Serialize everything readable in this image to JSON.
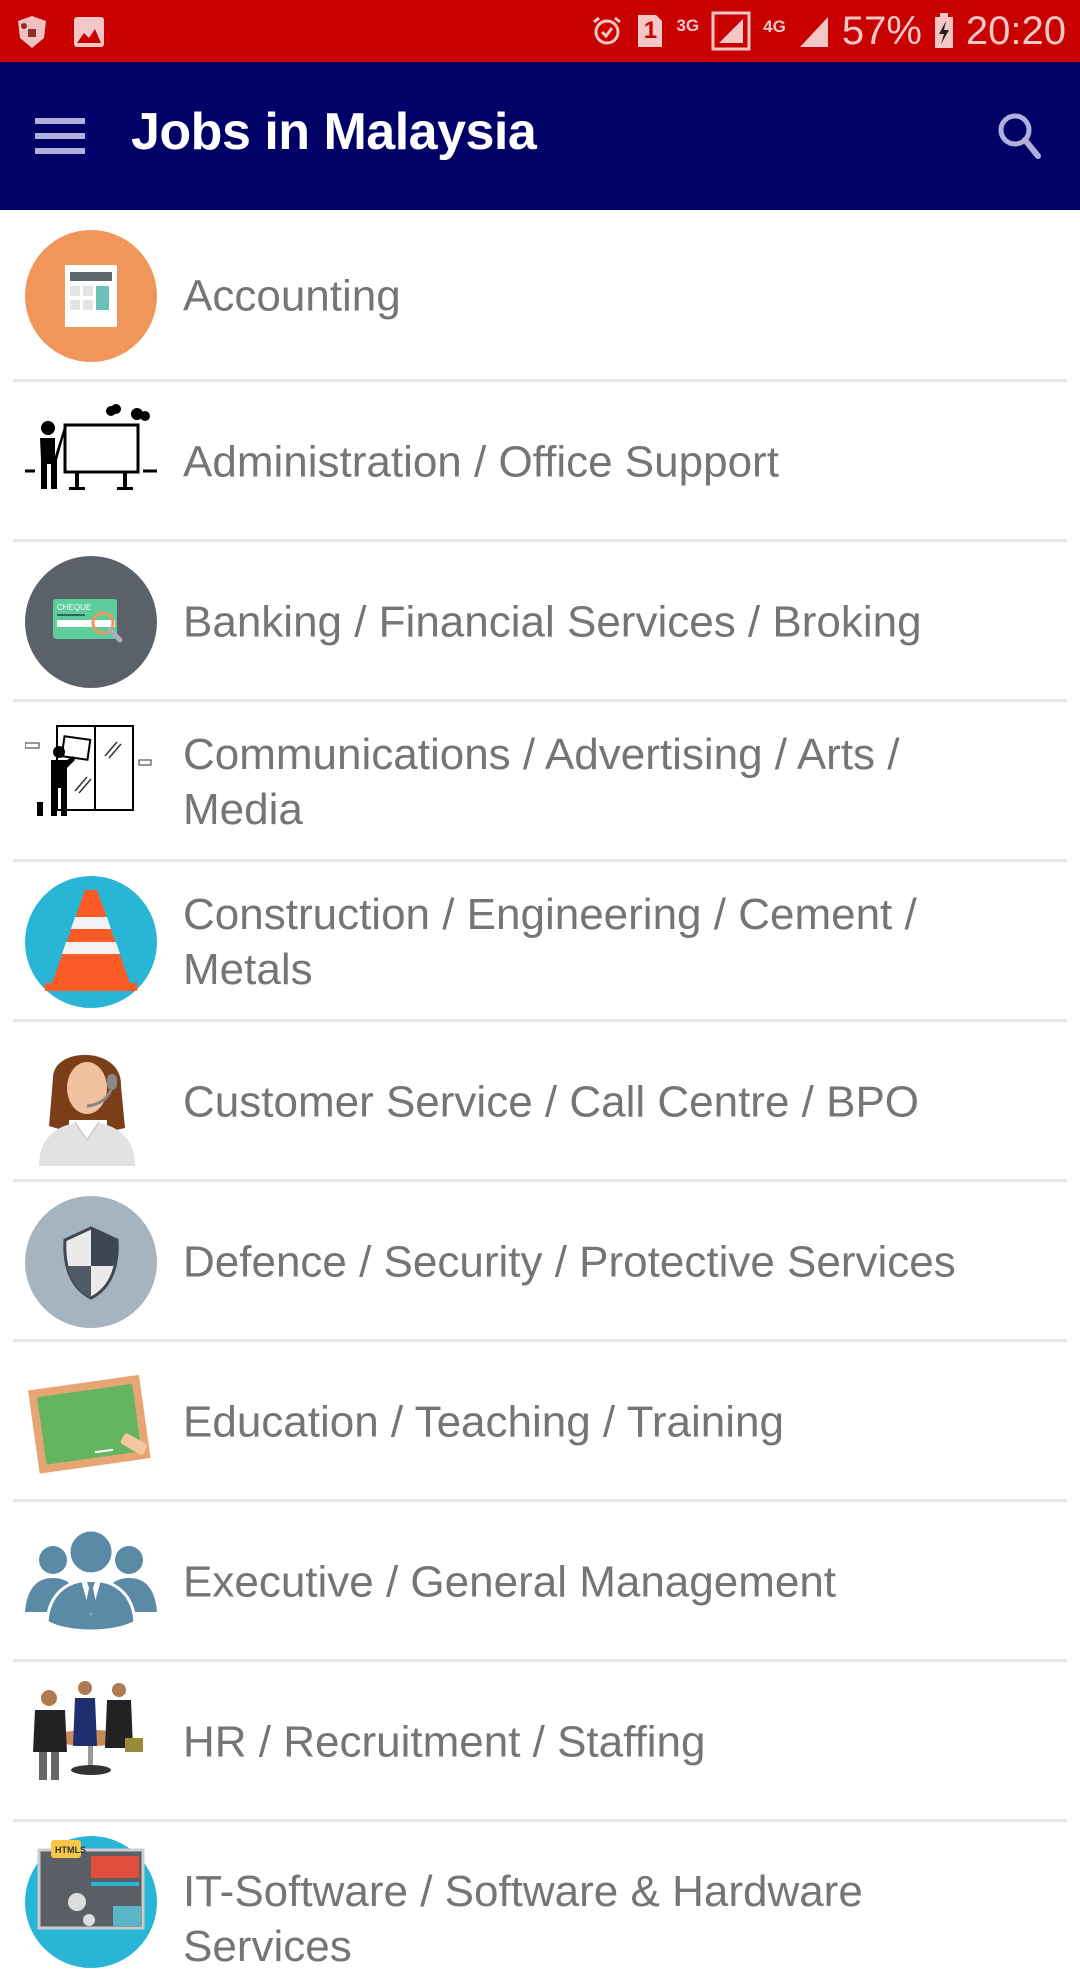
{
  "status_bar": {
    "left_icons": [
      "security-shield-icon",
      "image-icon"
    ],
    "alarm_icon": "alarm-icon",
    "sim_label": "1",
    "network_3g": "3G",
    "network_4g": "4G",
    "battery_percent": "57%",
    "time": "20:20",
    "colors": {
      "background": "#c80000",
      "foreground": "#f4c6c6"
    }
  },
  "toolbar": {
    "title": "Jobs in Malaysia",
    "menu_icon": "hamburger-menu-icon",
    "search_icon": "search-icon",
    "colors": {
      "background": "#000066",
      "title": "#ffffff"
    }
  },
  "categories": [
    {
      "label": "Accounting",
      "icon": "calculator-icon"
    },
    {
      "label": "Administration / Office Support",
      "icon": "presenter-board-icon"
    },
    {
      "label": "Banking / Financial Services / Broking",
      "icon": "cheque-magnifier-icon",
      "icon_text": "CHEQUE"
    },
    {
      "label": "Communications / Advertising / Arts / Media",
      "icon": "window-installer-icon"
    },
    {
      "label": "Construction / Engineering / Cement / Metals",
      "icon": "traffic-cone-icon"
    },
    {
      "label": "Customer Service / Call Centre / BPO",
      "icon": "call-centre-agent-icon"
    },
    {
      "label": "Defence / Security / Protective Services",
      "icon": "shield-icon"
    },
    {
      "label": "Education / Teaching / Training",
      "icon": "chalkboard-icon"
    },
    {
      "label": "Executive / General Management",
      "icon": "executives-group-icon"
    },
    {
      "label": "HR / Recruitment / Staffing",
      "icon": "interview-panel-icon"
    },
    {
      "label": "IT-Software / Software & Hardware Services",
      "icon": "computer-html-icon",
      "icon_text": "HTMLS"
    }
  ],
  "colors": {
    "label_text": "#757575",
    "separator": "#e6e6e6"
  }
}
